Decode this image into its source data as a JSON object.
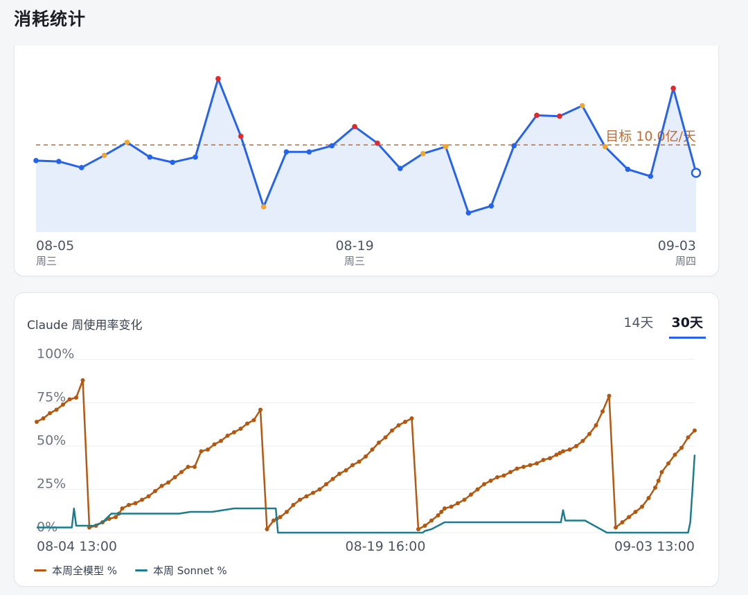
{
  "page_title": "消耗统计",
  "chart_data": [
    {
      "type": "line",
      "title": "",
      "x_labels": [
        {
          "date": "08-05",
          "weekday": "周三"
        },
        {
          "date": "08-19",
          "weekday": "周三"
        },
        {
          "date": "09-03",
          "weekday": "周四"
        }
      ],
      "x": [
        "08-05",
        "08-06",
        "08-07",
        "08-08",
        "08-09",
        "08-10",
        "08-11",
        "08-12",
        "08-13",
        "08-14",
        "08-15",
        "08-16",
        "08-17",
        "08-18",
        "08-19",
        "08-20",
        "08-21",
        "08-22",
        "08-23",
        "08-24",
        "08-25",
        "08-26",
        "08-27",
        "08-28",
        "08-29",
        "08-30",
        "08-31",
        "09-01",
        "09-02",
        "09-03"
      ],
      "values": [
        8.2,
        8.1,
        7.4,
        8.8,
        10.3,
        8.6,
        8.0,
        8.6,
        17.6,
        11.0,
        2.9,
        9.2,
        9.2,
        9.9,
        12.1,
        10.2,
        7.3,
        9.0,
        9.8,
        2.2,
        3.0,
        9.9,
        13.4,
        13.3,
        14.5,
        9.8,
        7.2,
        6.4,
        16.5,
        6.8
      ],
      "status": [
        "normal",
        "normal",
        "normal",
        "warn",
        "warn",
        "normal",
        "normal",
        "normal",
        "over",
        "over",
        "warn",
        "normal",
        "normal",
        "normal",
        "over",
        "over",
        "normal",
        "warn",
        "warn",
        "normal",
        "normal",
        "normal",
        "over",
        "over",
        "warn",
        "warn",
        "normal",
        "normal",
        "over",
        "current"
      ],
      "target": {
        "value": 10.0,
        "label": "目标 10.0亿/天"
      },
      "colors": {
        "line": "#2563eb",
        "fill": "#e6edfb",
        "normal": "#2563eb",
        "warn": "#f0a631",
        "over": "#e0292b",
        "target": "#c56a2c"
      }
    },
    {
      "type": "line",
      "title": "Claude 周使用率变化",
      "tabs": [
        {
          "label": "14天",
          "active": false
        },
        {
          "label": "30天",
          "active": true
        }
      ],
      "y_ticks": [
        "0%",
        "25%",
        "50%",
        "75%",
        "100%"
      ],
      "ylim": [
        0,
        100
      ],
      "x_ticks": [
        "08-04 13:00",
        "08-19 16:00",
        "09-03 13:00"
      ],
      "xlim": [
        0,
        30
      ],
      "series": [
        {
          "name": "本周全模型 %",
          "color": "#b5570f",
          "x": [
            0.0,
            0.3,
            0.6,
            0.9,
            1.2,
            1.5,
            1.8,
            2.1,
            2.4,
            2.7,
            3.0,
            3.3,
            3.6,
            3.75,
            3.9,
            4.2,
            4.5,
            4.8,
            5.1,
            5.4,
            5.7,
            6.0,
            6.3,
            6.6,
            6.9,
            7.2,
            7.5,
            7.8,
            8.1,
            8.4,
            8.7,
            9.0,
            9.3,
            9.6,
            9.9,
            10.2,
            10.5,
            10.8,
            10.95,
            11.1,
            11.4,
            11.7,
            12.0,
            12.3,
            12.6,
            12.9,
            13.2,
            13.5,
            13.8,
            14.1,
            14.4,
            14.7,
            15.0,
            15.3,
            15.6,
            15.9,
            16.2,
            16.5,
            16.8,
            17.1,
            17.4,
            17.7,
            18.0,
            18.3,
            18.45,
            18.6,
            18.9,
            19.2,
            19.5,
            19.8,
            20.1,
            20.4,
            20.7,
            21.0,
            21.3,
            21.6,
            21.9,
            22.2,
            22.5,
            22.8,
            23.1,
            23.4,
            23.7,
            23.85,
            24.0,
            24.3,
            24.6,
            24.9,
            25.2,
            25.5,
            25.8,
            26.1,
            26.4,
            26.7,
            27.0,
            27.3,
            27.6,
            27.9,
            28.2,
            28.35,
            28.5,
            28.8,
            29.1,
            29.4,
            29.7,
            30.0
          ],
          "y": [
            64,
            66,
            69,
            71,
            74,
            77,
            78,
            88,
            3,
            4,
            6,
            8,
            9,
            11,
            14,
            16,
            17,
            19,
            21,
            24,
            27,
            29,
            32,
            35,
            38,
            38,
            47,
            48,
            51,
            53,
            56,
            58,
            60,
            63,
            65,
            71,
            2,
            7,
            8,
            9,
            12,
            16,
            19,
            21,
            23,
            25,
            28,
            31,
            34,
            36,
            39,
            41,
            44,
            48,
            52,
            55,
            59,
            62,
            64,
            66,
            2,
            4,
            7,
            10,
            12,
            14,
            15,
            17,
            19,
            22,
            25,
            28,
            30,
            32,
            33,
            35,
            37,
            38,
            39,
            40,
            42,
            43,
            45,
            46,
            47,
            48,
            50,
            53,
            57,
            62,
            70,
            79,
            3,
            6,
            9,
            12,
            15,
            20,
            26,
            30,
            35,
            40,
            45,
            49,
            55,
            59
          ],
          "marker": true
        },
        {
          "name": "本周 Sonnet %",
          "color": "#1c7c8f",
          "x": [
            0.0,
            1.6,
            1.7,
            1.8,
            1.9,
            2.6,
            3.0,
            3.4,
            4.0,
            5.0,
            6.5,
            7.0,
            7.2,
            8.0,
            9.0,
            10.2,
            10.9,
            11.0,
            13.0,
            16.5,
            17.6,
            17.7,
            18.0,
            18.3,
            18.6,
            19.5,
            20.5,
            21.5,
            22.5,
            23.0,
            23.5,
            23.9,
            24.0,
            24.1,
            25.0,
            26.0,
            27.0,
            28.0,
            29.0,
            29.5,
            29.7,
            29.8,
            29.9,
            30.0
          ],
          "y": [
            3,
            3,
            14,
            4,
            4,
            4,
            6,
            11,
            11,
            11,
            11,
            12,
            12,
            12,
            14,
            14,
            14,
            0,
            0,
            0,
            0,
            1,
            2,
            4,
            6,
            6,
            6,
            6,
            6,
            6,
            6,
            6,
            13,
            7,
            7,
            0,
            0,
            0,
            0,
            0,
            0,
            6,
            25,
            45
          ],
          "marker": false
        }
      ]
    }
  ]
}
